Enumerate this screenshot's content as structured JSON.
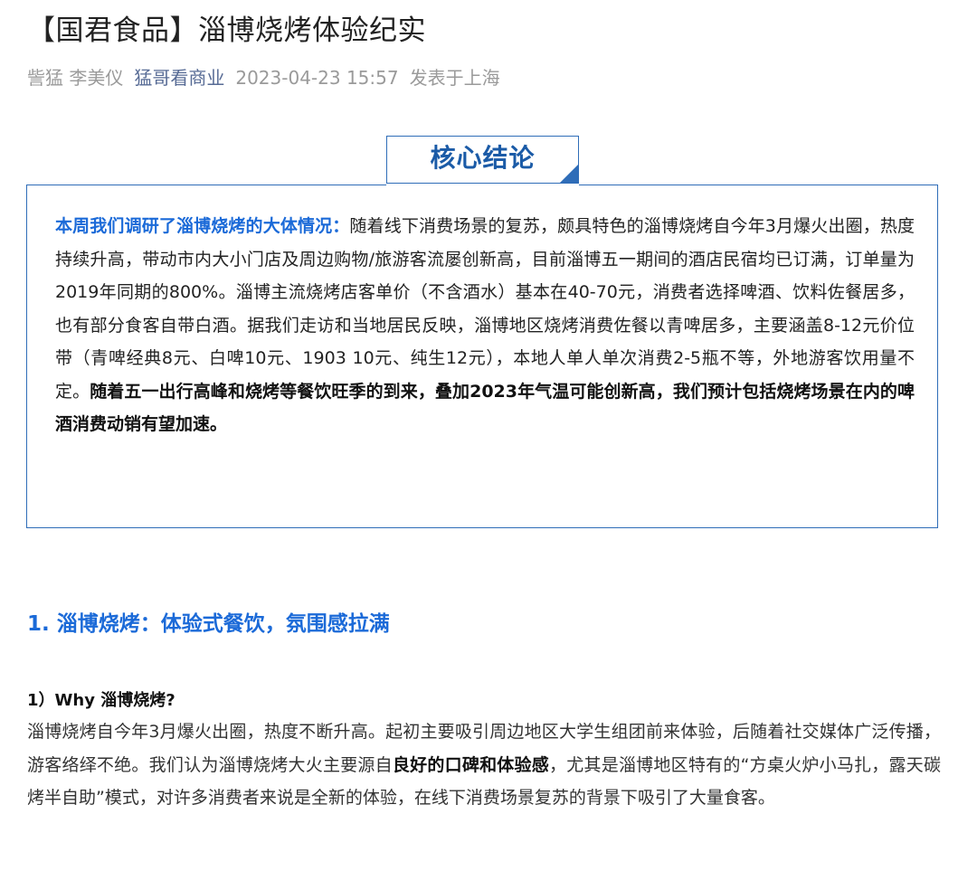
{
  "article": {
    "title": "【国君食品】淄博烧烤体验纪实",
    "authors": "訾猛 李美仪",
    "account": "猛哥看商业",
    "datetime": "2023-04-23 15:57",
    "location": "发表于上海"
  },
  "core_box": {
    "badge": "核心结论",
    "lead": "本周我们调研了淄博烧烤的大体情况：",
    "text": "随着线下消费场景的复苏，颇具特色的淄博烧烤自今年3月爆火出圈，热度持续升高，带动市内大小门店及周边购物/旅游客流屡创新高，目前淄博五一期间的酒店民宿均已订满，订单量为2019年同期的800%。淄博主流烧烤店客单价（不含酒水）基本在40-70元，消费者选择啤酒、饮料佐餐居多，也有部分食客自带白酒。据我们走访和当地居民反映，淄博地区烧烤消费佐餐以青啤居多，主要涵盖8-12元价位带（青啤经典8元、白啤10元、1903 10元、纯生12元），本地人单人单次消费2-5瓶不等，外地游客饮用量不定。",
    "emphasis": "随着五一出行高峰和烧烤等餐饮旺季的到来，叠加2023年气温可能创新高，我们预计包括烧烤场景在内的啤酒消费动销有望加速。"
  },
  "section1": {
    "heading": "1. 淄博烧烤：体验式餐饮，氛围感拉满",
    "sub_heading": "1）Why 淄博烧烤?",
    "para_before": "淄博烧烤自今年3月爆火出圈，热度不断升高。起初主要吸引周边地区大学生组团前来体验，后随着社交媒体广泛传播，游客络绎不绝。我们认为淄博烧烤大火主要源自",
    "para_bold": "良好的口碑和体验感",
    "para_after": "，尤其是淄博地区特有的“方桌火炉小马扎，露天碳烤半自助”模式，对许多消费者来说是全新的体验，在线下消费场景复苏的背景下吸引了大量食客。"
  },
  "colors": {
    "accent_blue": "#1b6ad8",
    "box_border": "#2f6db8",
    "meta_gray": "#9a9a9a",
    "account_link": "#576b95"
  }
}
